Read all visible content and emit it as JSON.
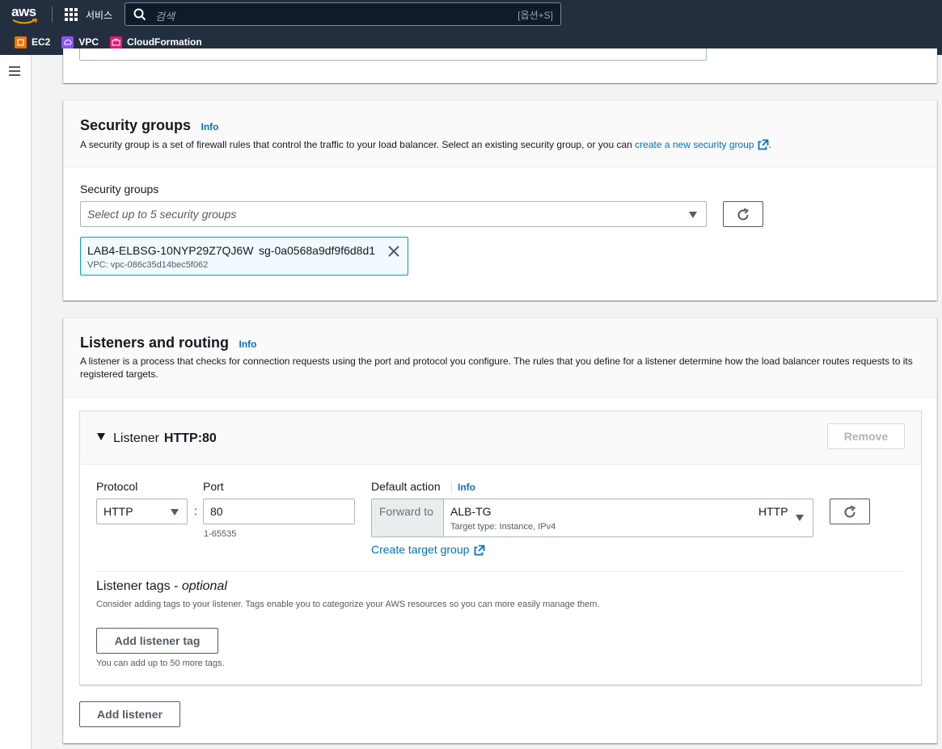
{
  "topnav": {
    "logo": "aws",
    "services_label": "서비스",
    "search_placeholder": "검색",
    "search_shortcut": "[옵션+S]",
    "favorites": [
      {
        "label": "EC2",
        "color": "#ed7100"
      },
      {
        "label": "VPC",
        "color": "#8c4fff"
      },
      {
        "label": "CloudFormation",
        "color": "#e7157b"
      }
    ]
  },
  "security_groups": {
    "title": "Security groups",
    "info": "Info",
    "description": "A security group is a set of firewall rules that control the traffic to your load balancer. Select an existing security group, or you can",
    "create_link": "create a new security group",
    "description_end": ".",
    "field_label": "Security groups",
    "select_placeholder": "Select up to 5 security groups",
    "token": {
      "name": "LAB4-ELBSG-10NYP29Z7QJ6W",
      "id": "sg-0a0568a9df9f6d8d1",
      "vpc": "VPC: vpc-086c35d14bec5f062"
    }
  },
  "listeners": {
    "title": "Listeners and routing",
    "info": "Info",
    "description": "A listener is a process that checks for connection requests using the port and protocol you configure. The rules that you define for a listener determine how the load balancer routes requests to its registered targets.",
    "listener": {
      "label": "Listener",
      "name": "HTTP:80",
      "remove_label": "Remove",
      "protocol_label": "Protocol",
      "protocol_value": "HTTP",
      "colon": ":",
      "port_label": "Port",
      "port_value": "80",
      "port_hint": "1-65535",
      "default_action_label": "Default action",
      "default_action_info": "Info",
      "forward_prefix": "Forward to",
      "target_group": "ALB-TG",
      "target_type": "Target type: Instance, IPv4",
      "target_protocol": "HTTP",
      "create_tg_link": "Create target group",
      "tags_title": "Listener tags - ",
      "tags_optional": "optional",
      "tags_description": "Consider adding tags to your listener. Tags enable you to categorize your AWS resources so you can more easily manage them.",
      "add_tag_label": "Add listener tag",
      "tags_hint": "You can add up to 50 more tags."
    },
    "add_listener_label": "Add listener"
  }
}
